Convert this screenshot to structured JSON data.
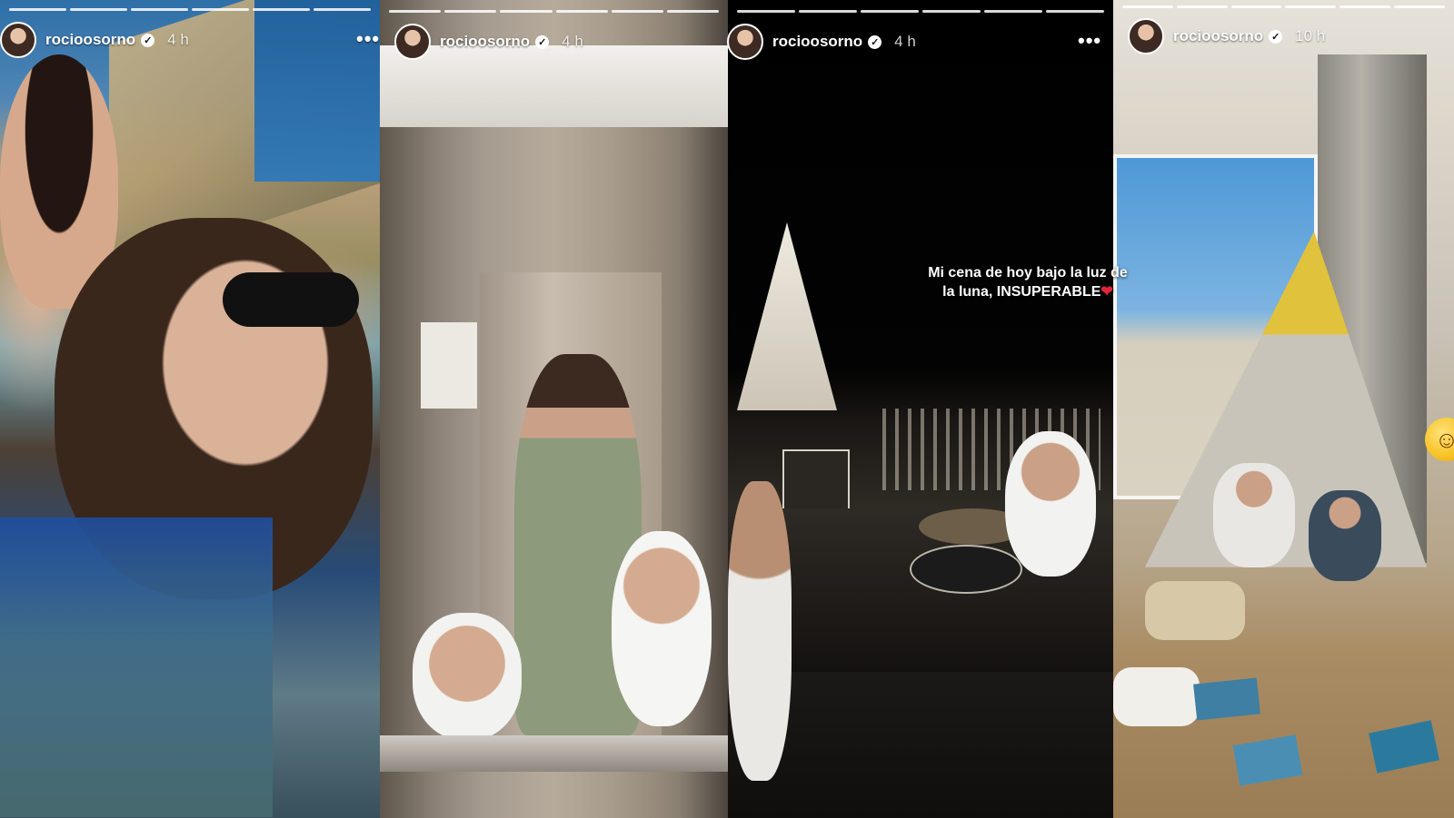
{
  "stories": [
    {
      "username": "rocioosorno",
      "time": "4 h",
      "more": "•••",
      "progress_segments": 6
    },
    {
      "username": "rocioosorno",
      "time": "4 h",
      "more": "",
      "progress_segments": 6
    },
    {
      "username": "rocioosorno",
      "time": "4 h",
      "more": "•••",
      "progress_segments": 6,
      "caption": "Mi cena de hoy bajo la luz de la luna, INSUPERABLE",
      "caption_emoji": "❤"
    },
    {
      "username": "rocioosorno",
      "time": "10 h",
      "more": "",
      "progress_segments": 6
    }
  ],
  "emoji": "☺",
  "colors": {
    "heart": "#e0253a",
    "verified_bg": "#ffffff"
  }
}
